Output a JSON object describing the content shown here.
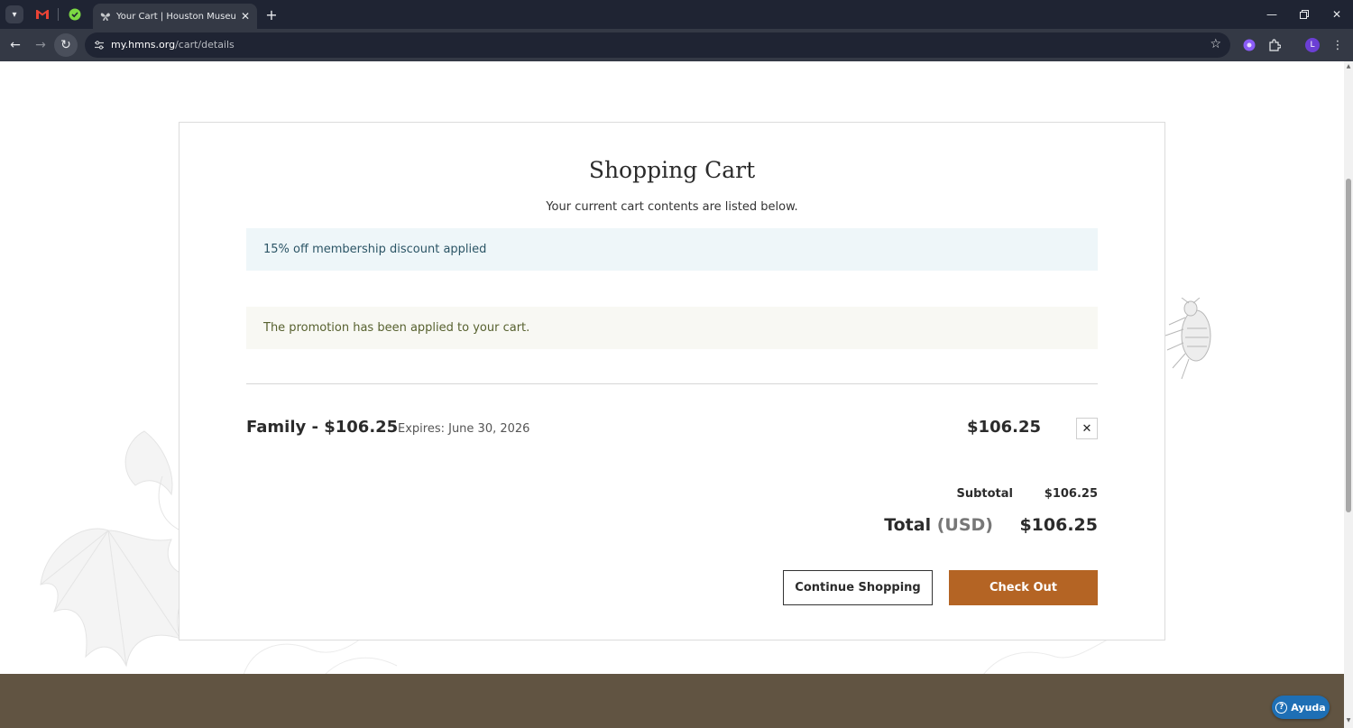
{
  "browser": {
    "tab_title": "Your Cart | Houston Museum of Natural Science",
    "url_host": "my.hmns.org",
    "url_path": "/cart/details",
    "new_tab_symbol": "+",
    "profile_initial": "L",
    "icons": {
      "tab_list": "chevron-down-icon",
      "gmail": "gmail-icon",
      "pinned_app": "checkmark-circle-icon",
      "favicon": "butterfly-icon",
      "back": "arrow-left-icon",
      "forward": "arrow-right-icon",
      "reload": "reload-icon",
      "site_info": "tune-icon",
      "bookmark": "star-icon",
      "extensions": "puzzle-icon",
      "menu": "kebab-icon"
    }
  },
  "cart": {
    "title": "Shopping Cart",
    "subtitle": "Your current cart contents are listed below.",
    "discount_notice": "15% off membership discount applied",
    "promotion_notice": "The promotion has been applied to your cart.",
    "items": [
      {
        "name": "Family - $106.25",
        "expires": "Expires: June 30, 2026",
        "price": "$106.25"
      }
    ],
    "remove_symbol": "✕",
    "subtotal_label": "Subtotal",
    "subtotal_value": "$106.25",
    "total_label": "Total",
    "total_currency": "(USD)",
    "total_value": "$106.25",
    "continue_label": "Continue Shopping",
    "checkout_label": "Check Out"
  },
  "help": {
    "label": "Ayuda",
    "icon_glyph": "?"
  },
  "colors": {
    "checkout": "#b46424",
    "footer": "#615442",
    "info_bg": "#eef6f9",
    "success_bg": "#f8f8f3",
    "help": "#1e6fb5"
  }
}
